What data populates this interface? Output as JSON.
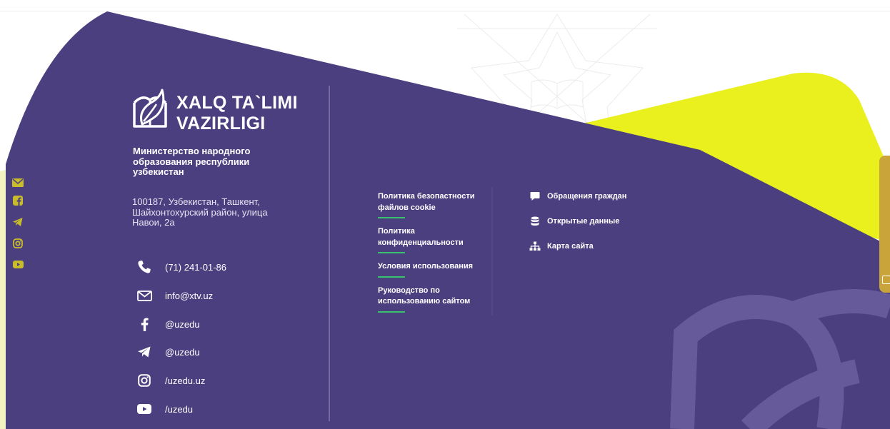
{
  "logo": {
    "line1": "XALQ TA`LIMI",
    "line2": "VAZIRLIGI"
  },
  "ministry_name": "Министерство народного образования республики узбекистан",
  "address": "100187, Узбекистан, Ташкент, Шайхонтохурский район, улица Навои, 2a",
  "contacts": [
    {
      "icon": "phone-icon",
      "text": "(71) 241-01-86"
    },
    {
      "icon": "mail-icon",
      "text": "info@xtv.uz"
    },
    {
      "icon": "facebook-icon",
      "text": "@uzedu"
    },
    {
      "icon": "telegram-icon",
      "text": "@uzedu"
    },
    {
      "icon": "instagram-icon",
      "text": "/uzedu.uz"
    },
    {
      "icon": "youtube-icon",
      "text": "/uzedu"
    }
  ],
  "policies": [
    "Политика безопастности файлов cookie",
    "Политика конфиденциальности",
    "Условия использования",
    "Руководство по использованию сайтом"
  ],
  "links": [
    {
      "icon": "chat-icon",
      "label": "Обращения граждан"
    },
    {
      "icon": "database-icon",
      "label": "Открытые данные"
    },
    {
      "icon": "sitemap-icon",
      "label": "Карта сайта"
    }
  ],
  "side_social": [
    "mail-icon",
    "facebook-icon",
    "telegram-icon",
    "instagram-icon",
    "youtube-icon"
  ],
  "colors": {
    "purple": "#4b3f80",
    "yellow": "#e9f01e",
    "green_line": "#37c36c",
    "side_icon": "#c8bc2a",
    "tab": "#c9a43a"
  }
}
